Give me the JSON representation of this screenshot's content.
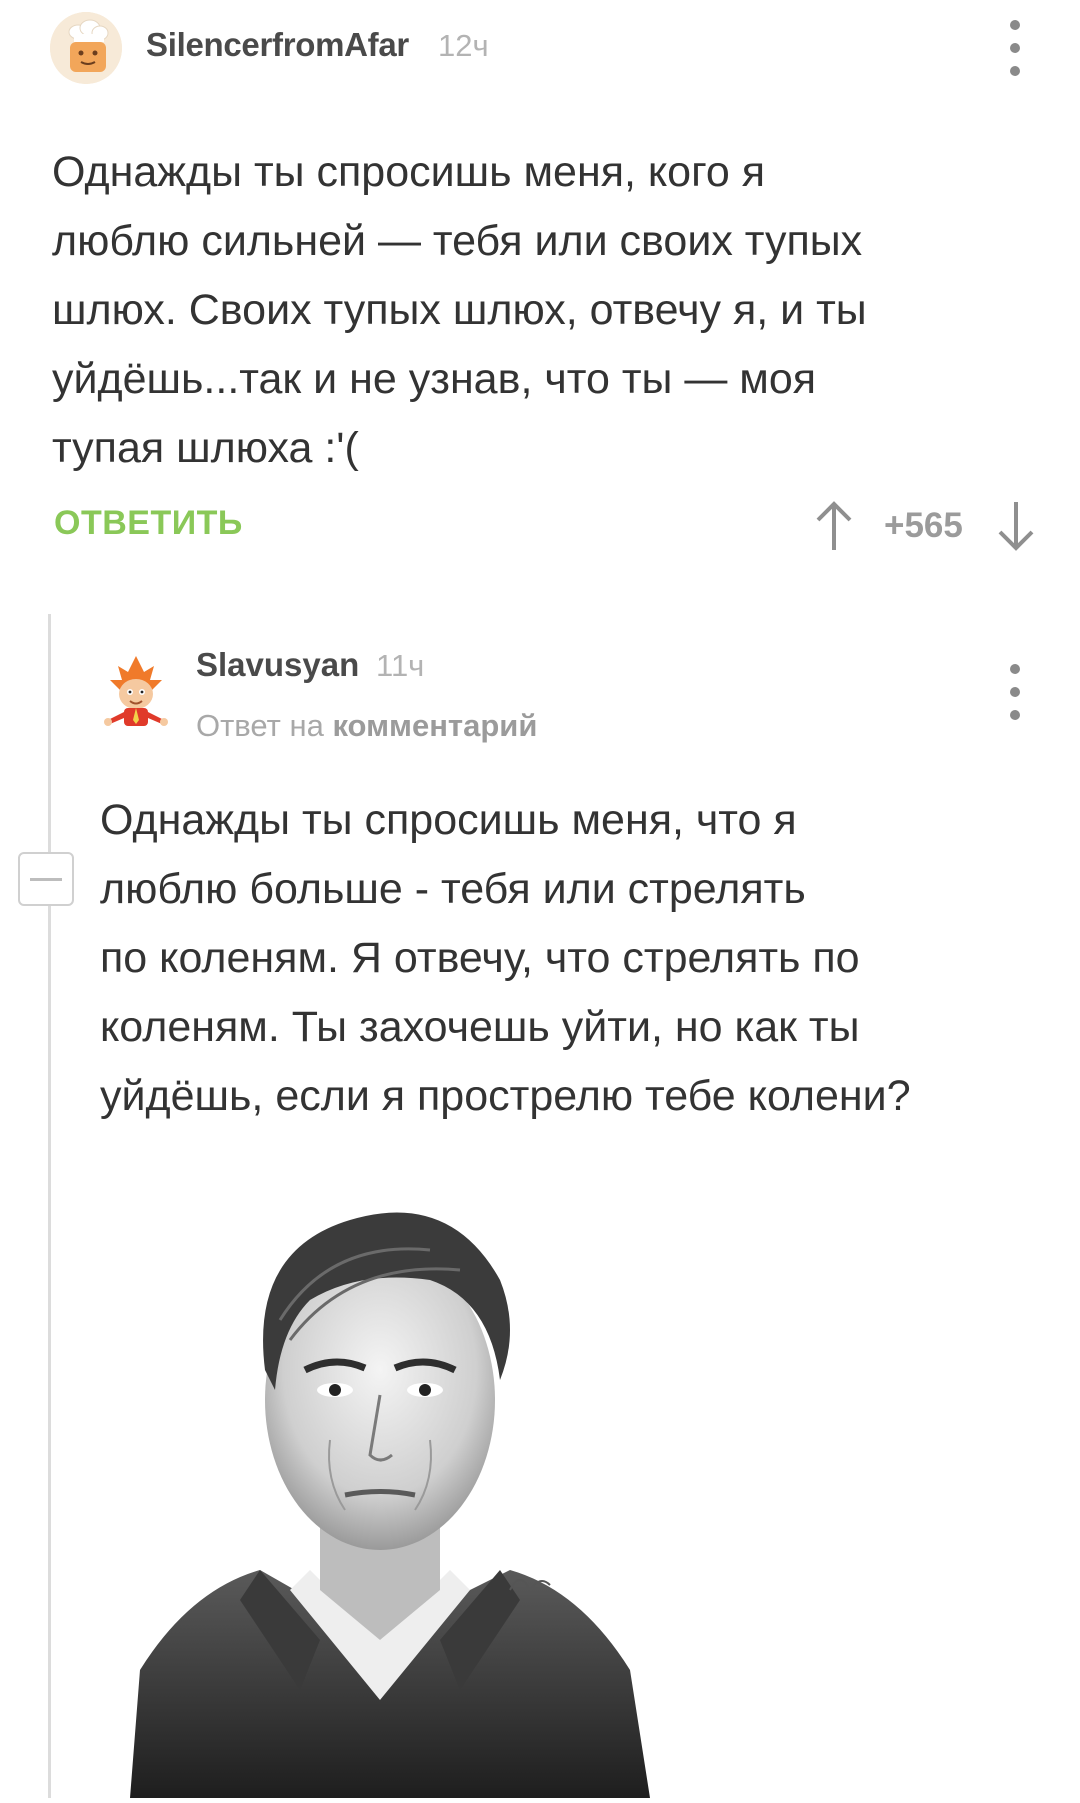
{
  "comments": [
    {
      "author": "SilencerfromAfar",
      "time": "12ч",
      "text_lines": [
        "Однажды ты спросишь меня, кого я",
        "люблю сильней — тебя или своих тупых",
        "шлюх. Своих тупых шлюх, отвечу я, и ты",
        "уйдёшь...так и не узнав, что ты — моя",
        "тупая шлюха :'("
      ],
      "reply_label": "ОТВЕТИТЬ",
      "score": "+565"
    },
    {
      "author": "Slavusyan",
      "time": "11ч",
      "reply_prefix": "Ответ на",
      "reply_target": "комментарий",
      "text_lines": [
        "Однажды ты спросишь меня, что я",
        "люблю больше - тебя или стрелять",
        "по коленям. Я отвечу, что стрелять по",
        "коленям. Ты захочешь уйти, но как ты",
        "уйдёшь, если я прострелю тебе колени?"
      ]
    }
  ],
  "colors": {
    "accent_green": "#8ac858",
    "muted_text": "#b3b3b3",
    "body_text": "#333333"
  },
  "icons": {
    "more": "more-vertical-icon",
    "vote_up": "arrow-up-icon",
    "vote_down": "arrow-down-icon",
    "collapse": "minus-icon"
  }
}
